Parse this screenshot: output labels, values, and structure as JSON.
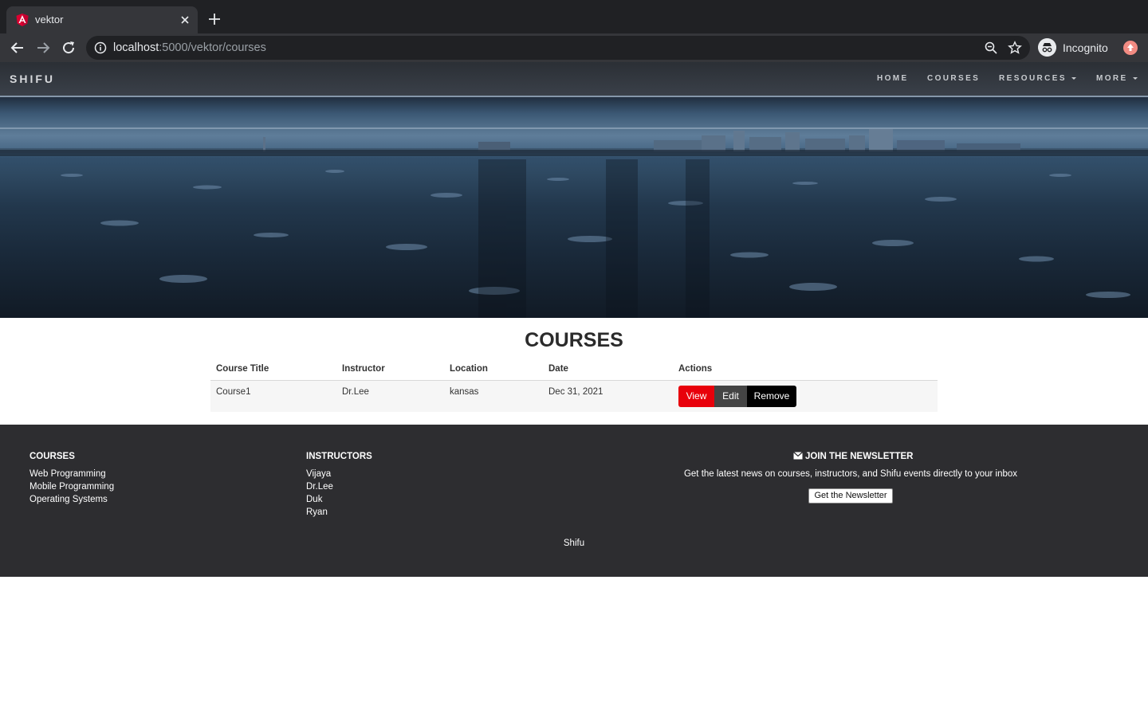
{
  "browser": {
    "tab_title": "vektor",
    "url_host": "localhost",
    "url_path": ":5000/vektor/courses",
    "profile_label": "Incognito"
  },
  "site": {
    "brand": "SHIFU",
    "nav": [
      {
        "label": "HOME"
      },
      {
        "label": "COURSES"
      },
      {
        "label": "RESOURCES"
      },
      {
        "label": "MORE"
      }
    ]
  },
  "main": {
    "heading": "COURSES",
    "columns": [
      "Course Title",
      "Instructor",
      "Location",
      "Date",
      "Actions"
    ],
    "rows": [
      {
        "title": "Course1",
        "instructor": "Dr.Lee",
        "location": "kansas",
        "date": "Dec 31, 2021"
      }
    ],
    "actions": {
      "view": "View",
      "edit": "Edit",
      "remove": "Remove"
    }
  },
  "footer": {
    "courses_heading": "COURSES",
    "courses": [
      "Web Programming",
      "Mobile Programming",
      "Operating Systems"
    ],
    "instructors_heading": "INSTRUCTORS",
    "instructors": [
      "Vijaya",
      "Dr.Lee",
      "Duk",
      "Ryan"
    ],
    "newsletter_heading": "JOIN THE NEWSLETTER",
    "newsletter_text": "Get the latest news on courses, instructors, and Shifu events directly to your inbox",
    "newsletter_button": "Get the Newsletter",
    "brand": "Shifu"
  },
  "colors": {
    "view": "#e8000b",
    "edit": "#444444",
    "remove": "#000000",
    "footer_bg": "#2d2d30"
  }
}
